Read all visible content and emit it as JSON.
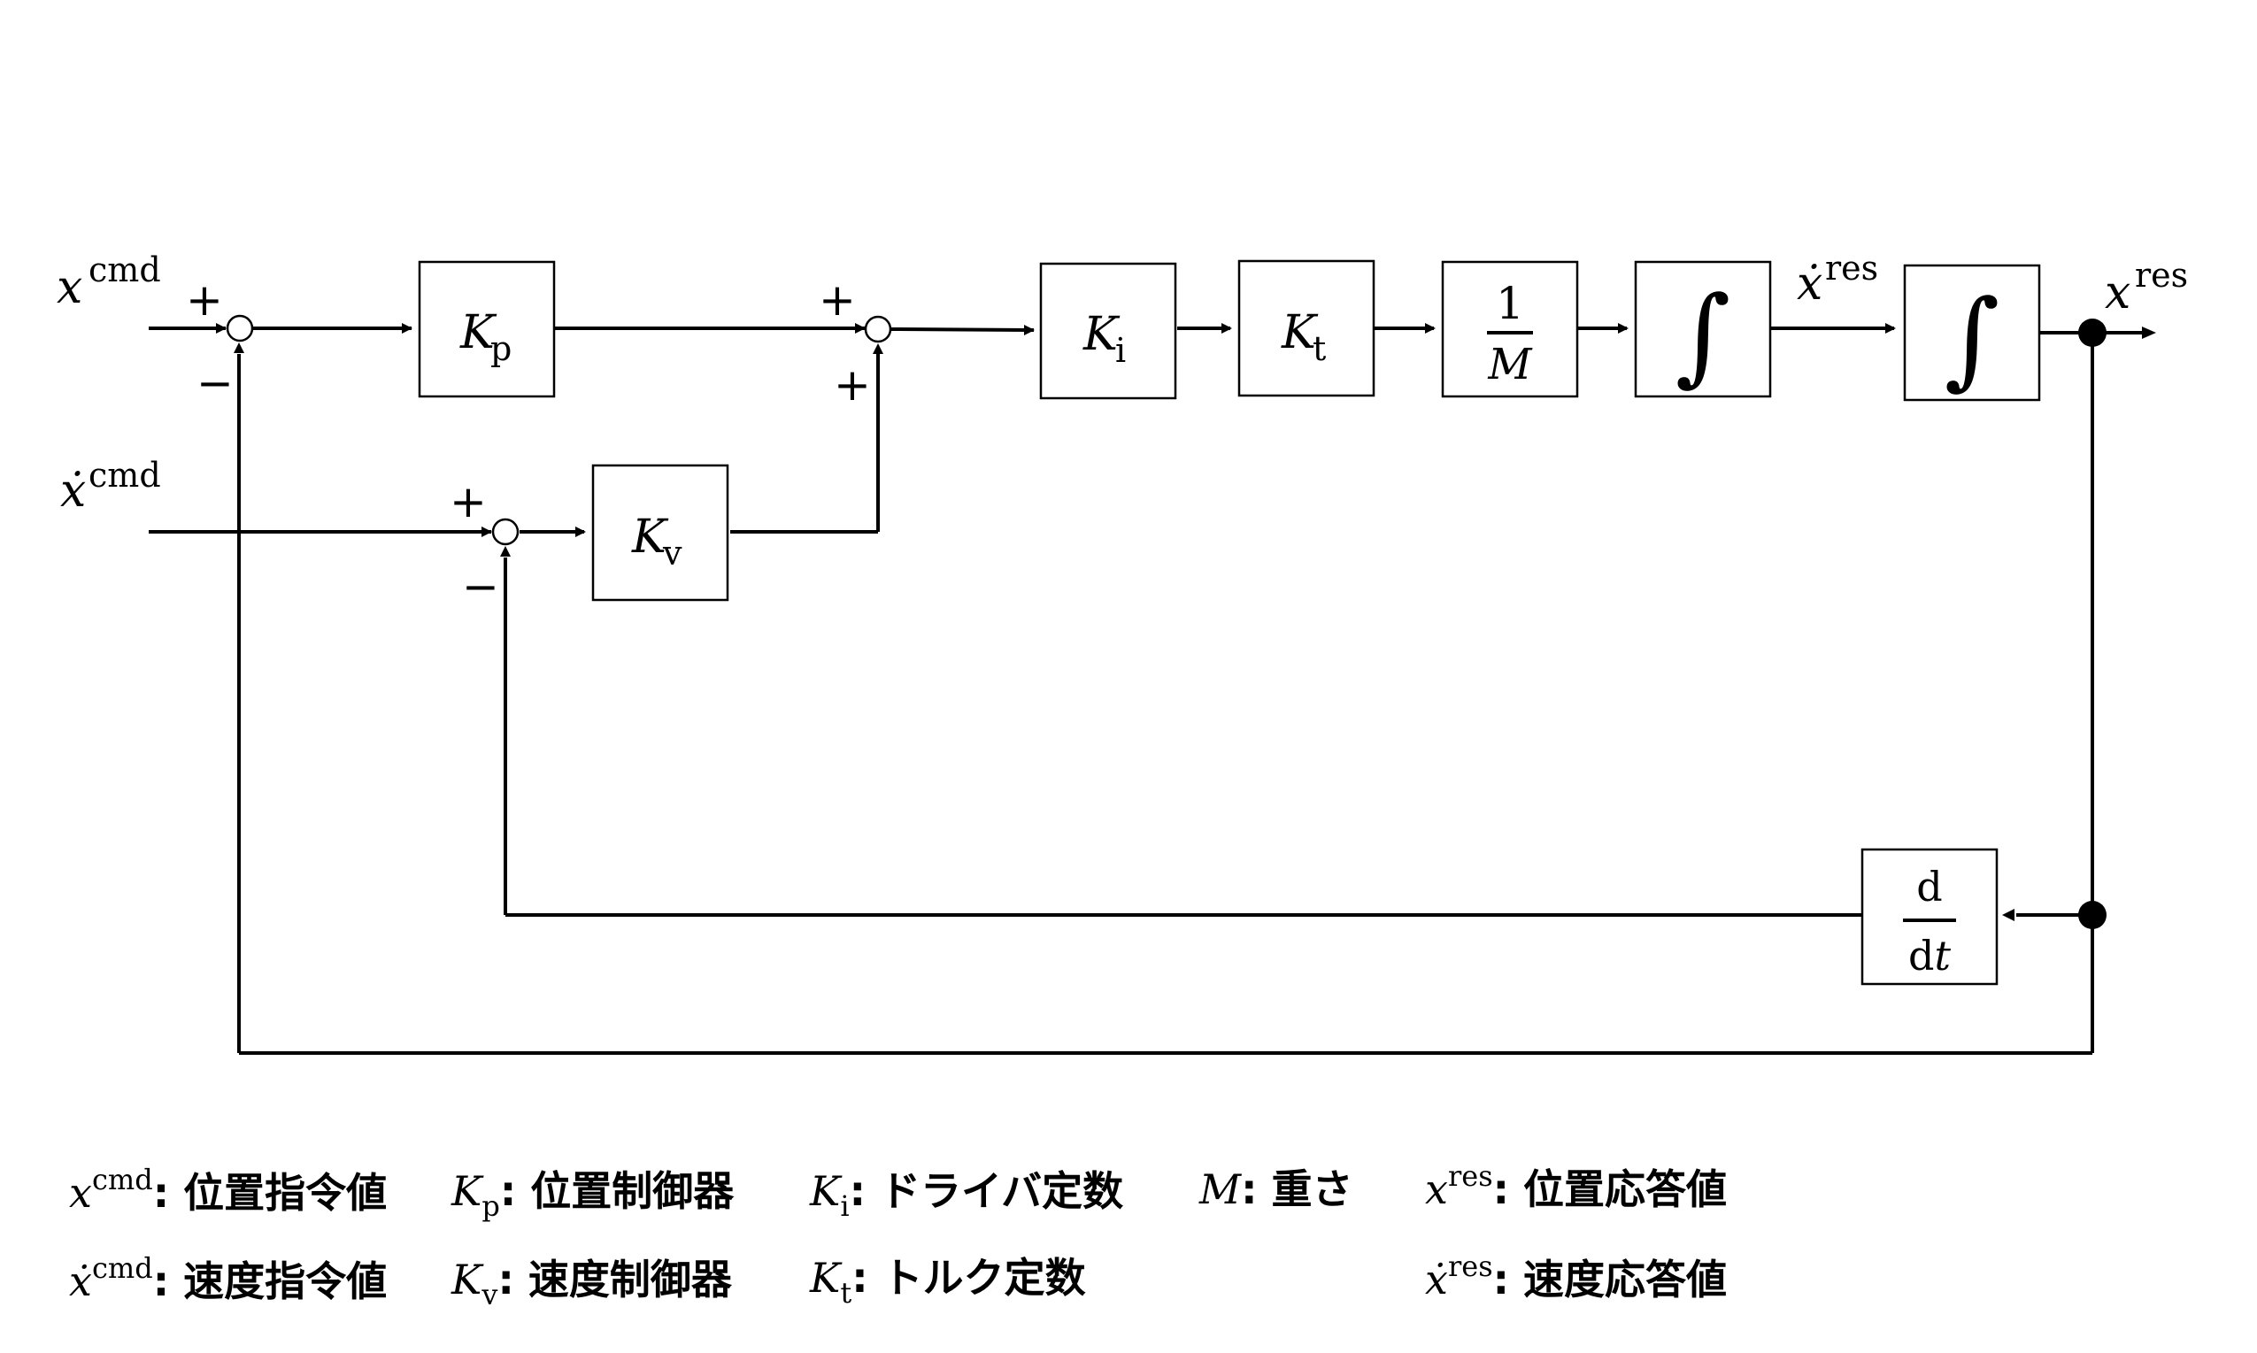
{
  "blocks": {
    "kp": {
      "sym": "K",
      "sub": "p"
    },
    "kv": {
      "sym": "K",
      "sub": "v"
    },
    "ki": {
      "sym": "K",
      "sub": "i"
    },
    "kt": {
      "sym": "K",
      "sub": "t"
    },
    "mass": {
      "num": "1",
      "den": "M"
    },
    "int1": "∫",
    "int2": "∫",
    "deriv": {
      "num": "d",
      "den_d": "d",
      "den_t": "t"
    }
  },
  "signals": {
    "x_cmd": {
      "sym": "x",
      "sup": "cmd"
    },
    "xdot_cmd": {
      "sym": "ẋ",
      "sup": "cmd"
    },
    "xdot_res": {
      "sym": "ẋ",
      "sup": "res"
    },
    "x_res": {
      "sym": "x",
      "sup": "res"
    }
  },
  "signs": {
    "plus": "+",
    "minus": "−"
  },
  "legend": {
    "x_cmd": {
      "sym": "x",
      "sup": "cmd",
      "text": ": 位置指令値"
    },
    "xdot_cmd": {
      "sym": "ẋ",
      "sup": "cmd",
      "text": ": 速度指令値"
    },
    "kp": {
      "sym": "K",
      "sub": "p",
      "text": ": 位置制御器"
    },
    "kv": {
      "sym": "K",
      "sub": "v",
      "text": ": 速度制御器"
    },
    "ki": {
      "sym": "K",
      "sub": "i",
      "text": ": ドライバ定数"
    },
    "kt": {
      "sym": "K",
      "sub": "t",
      "text": ": トルク定数"
    },
    "m": {
      "sym": "M",
      "text": ": 重さ"
    },
    "x_res": {
      "sym": "x",
      "sup": "res",
      "text": ": 位置応答値"
    },
    "xdot_res": {
      "sym": "ẋ",
      "sup": "res",
      "text": ": 速度応答値"
    }
  }
}
